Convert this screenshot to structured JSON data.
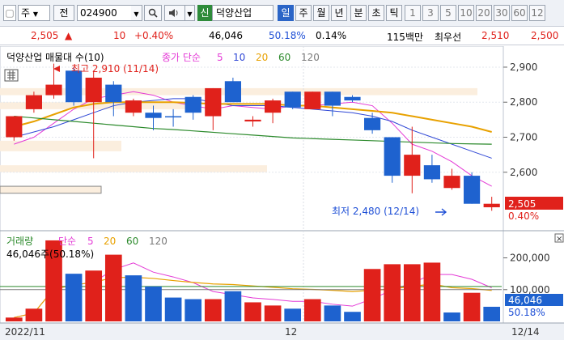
{
  "toolbar": {
    "market": "주",
    "period_label": "전",
    "code": "024900",
    "credit_badge": "신",
    "stock_name": "덕양산업",
    "periods": [
      "일",
      "주",
      "월",
      "년",
      "분",
      "초",
      "틱"
    ],
    "selected_period": "일",
    "intervals": [
      "1",
      "3",
      "5",
      "10",
      "20",
      "30",
      "60",
      "12"
    ]
  },
  "quote": {
    "price": "2,505",
    "arrow": "▲",
    "change": "10",
    "change_pct": "+0.40%",
    "volume": "46,046",
    "vol_ratio": "50.18%",
    "turnover": "0.14%",
    "amount": "115백만",
    "bid_label": "최우선",
    "bid": "2,510",
    "ask": "2,500"
  },
  "price_panel": {
    "legend_title": "덕양산업 매물대 수(10)",
    "ma_label": "종가 단순",
    "ma_periods": [
      "5",
      "10",
      "20",
      "60",
      "120"
    ],
    "high_label": "최고 2,910 (11/14)",
    "low_label": "최저 2,480 (12/14)",
    "axis_ticks": [
      "2,900",
      "2,800",
      "2,700",
      "2,600"
    ],
    "current_price": "2,505",
    "current_pct": "0.40%"
  },
  "volume_panel": {
    "legend_title": "거래량",
    "ma_label": "단순",
    "ma_periods": [
      "5",
      "20",
      "60",
      "120"
    ],
    "value_text": "46,046주(50.18%)",
    "axis_ticks": [
      "200,000",
      "100,000"
    ],
    "current_volume": "46,046",
    "current_pct": "50.18%",
    "close_icon": "×"
  },
  "date_axis": {
    "labels": [
      "2022/11",
      "12",
      "12/14"
    ]
  },
  "colors": {
    "up": "#e0211b",
    "down": "#1e62cf",
    "ma5": "#e43ad6",
    "ma10": "#3048d6",
    "ma20": "#e8a100",
    "ma60": "#2c8a2c",
    "ma120": "#7a7a7a"
  },
  "chart_data": {
    "type": "candlestick",
    "ylim": [
      2440,
      2960
    ],
    "candles": [
      {
        "o": 2700,
        "h": 2760,
        "l": 2690,
        "c": 2760,
        "up": true
      },
      {
        "o": 2780,
        "h": 2830,
        "l": 2770,
        "c": 2820,
        "up": true
      },
      {
        "o": 2820,
        "h": 2910,
        "l": 2810,
        "c": 2850,
        "up": true
      },
      {
        "o": 2890,
        "h": 2900,
        "l": 2790,
        "c": 2800,
        "up": false
      },
      {
        "o": 2800,
        "h": 2890,
        "l": 2640,
        "c": 2870,
        "up": true
      },
      {
        "o": 2850,
        "h": 2860,
        "l": 2760,
        "c": 2800,
        "up": false
      },
      {
        "o": 2770,
        "h": 2810,
        "l": 2760,
        "c": 2805,
        "up": true
      },
      {
        "o": 2770,
        "h": 2790,
        "l": 2720,
        "c": 2755,
        "up": false
      },
      {
        "o": 2760,
        "h": 2780,
        "l": 2730,
        "c": 2760,
        "up": false
      },
      {
        "o": 2815,
        "h": 2820,
        "l": 2750,
        "c": 2770,
        "up": false
      },
      {
        "o": 2760,
        "h": 2840,
        "l": 2720,
        "c": 2840,
        "up": true
      },
      {
        "o": 2860,
        "h": 2870,
        "l": 2800,
        "c": 2800,
        "up": false
      },
      {
        "o": 2745,
        "h": 2760,
        "l": 2730,
        "c": 2750,
        "up": true
      },
      {
        "o": 2770,
        "h": 2810,
        "l": 2740,
        "c": 2805,
        "up": true
      },
      {
        "o": 2830,
        "h": 2830,
        "l": 2780,
        "c": 2785,
        "up": false
      },
      {
        "o": 2780,
        "h": 2830,
        "l": 2780,
        "c": 2830,
        "up": true
      },
      {
        "o": 2830,
        "h": 2830,
        "l": 2760,
        "c": 2790,
        "up": false
      },
      {
        "o": 2815,
        "h": 2820,
        "l": 2800,
        "c": 2805,
        "up": false
      },
      {
        "o": 2755,
        "h": 2770,
        "l": 2710,
        "c": 2720,
        "up": false
      },
      {
        "o": 2700,
        "h": 2700,
        "l": 2570,
        "c": 2590,
        "up": false
      },
      {
        "o": 2590,
        "h": 2730,
        "l": 2540,
        "c": 2650,
        "up": true
      },
      {
        "o": 2620,
        "h": 2650,
        "l": 2570,
        "c": 2580,
        "up": false
      },
      {
        "o": 2590,
        "h": 2610,
        "l": 2550,
        "c": 2555,
        "up": true
      },
      {
        "o": 2590,
        "h": 2600,
        "l": 2510,
        "c": 2510,
        "up": false
      },
      {
        "o": 2500,
        "h": 2530,
        "l": 2490,
        "c": 2510,
        "up": true
      }
    ],
    "ma": {
      "ma5": [
        2680,
        2700,
        2740,
        2780,
        2810,
        2820,
        2830,
        2820,
        2800,
        2790,
        2780,
        2790,
        2785,
        2780,
        2790,
        2790,
        2795,
        2800,
        2790,
        2740,
        2680,
        2660,
        2630,
        2590,
        2560
      ],
      "ma10": [
        2700,
        2715,
        2730,
        2750,
        2770,
        2790,
        2800,
        2805,
        2810,
        2810,
        2800,
        2790,
        2790,
        2790,
        2785,
        2780,
        2775,
        2770,
        2760,
        2745,
        2720,
        2700,
        2680,
        2660,
        2640
      ],
      "ma20": [
        2730,
        2745,
        2765,
        2785,
        2795,
        2800,
        2800,
        2800,
        2800,
        2798,
        2795,
        2795,
        2795,
        2795,
        2790,
        2790,
        2785,
        2780,
        2775,
        2770,
        2760,
        2750,
        2740,
        2730,
        2715
      ],
      "ma60": [
        2760,
        2755,
        2750,
        2745,
        2740,
        2735,
        2730,
        2725,
        2722,
        2718,
        2714,
        2710,
        2706,
        2702,
        2698,
        2696,
        2694,
        2692,
        2690,
        2688,
        2686,
        2684,
        2682,
        2681,
        2680
      ]
    },
    "volume": {
      "ylim": [
        0,
        260000
      ],
      "values": [
        12000,
        40000,
        255000,
        150000,
        160000,
        210000,
        145000,
        110000,
        75000,
        70000,
        70000,
        95000,
        60000,
        50000,
        40000,
        70000,
        50000,
        30000,
        165000,
        180000,
        180000,
        185000,
        28000,
        90000,
        46000
      ],
      "up": [
        true,
        true,
        true,
        false,
        true,
        true,
        false,
        false,
        false,
        false,
        true,
        false,
        true,
        true,
        false,
        true,
        false,
        false,
        true,
        true,
        true,
        true,
        false,
        true,
        false
      ]
    }
  }
}
